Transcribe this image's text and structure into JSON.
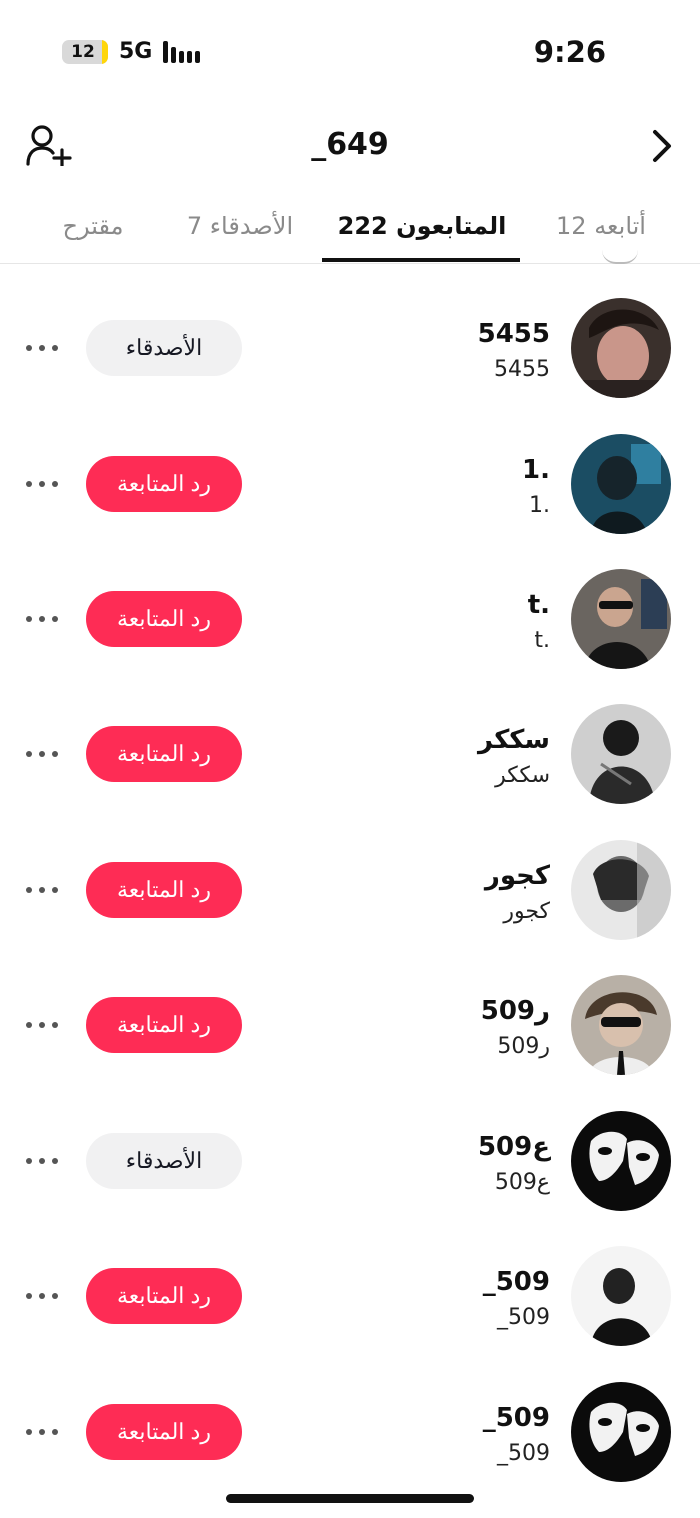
{
  "status_bar": {
    "battery": "12",
    "network": "5G",
    "time": "9:26"
  },
  "header": {
    "title": "_649",
    "add_friend_icon": "person-plus-icon",
    "back_icon": "chevron-right-icon"
  },
  "tabs": [
    {
      "label": "أتابعه 12",
      "active": false
    },
    {
      "label": "المتابعون 222",
      "active": true
    },
    {
      "label": "الأصدقاء 7",
      "active": false
    },
    {
      "label": "مقترح",
      "active": false
    }
  ],
  "colors": {
    "follow_back": "#fe2c55",
    "friends_button": "#f1f1f2",
    "active_tab": "#111111",
    "inactive_tab": "#8a8a8a"
  },
  "followers": [
    {
      "name": "5455",
      "handle": "5455",
      "button": "الأصدقاء",
      "button_type": "friends"
    },
    {
      "name": "1.",
      "handle": "1.",
      "button": "رد المتابعة",
      "button_type": "follow"
    },
    {
      "name": "t.",
      "handle": "t.",
      "button": "رد المتابعة",
      "button_type": "follow"
    },
    {
      "name": "سككر",
      "handle": "سككر",
      "button": "رد المتابعة",
      "button_type": "follow"
    },
    {
      "name": "كجور",
      "handle": "كجور",
      "button": "رد المتابعة",
      "button_type": "follow"
    },
    {
      "name": "ر509",
      "handle": "ر509",
      "button": "رد المتابعة",
      "button_type": "follow"
    },
    {
      "name": "ع509",
      "handle": "ع509",
      "button": "الأصدقاء",
      "button_type": "friends"
    },
    {
      "name": "_509",
      "handle": "_509",
      "button": "رد المتابعة",
      "button_type": "follow"
    },
    {
      "name": "_509",
      "handle": "_509",
      "button": "رد المتابعة",
      "button_type": "follow"
    }
  ]
}
